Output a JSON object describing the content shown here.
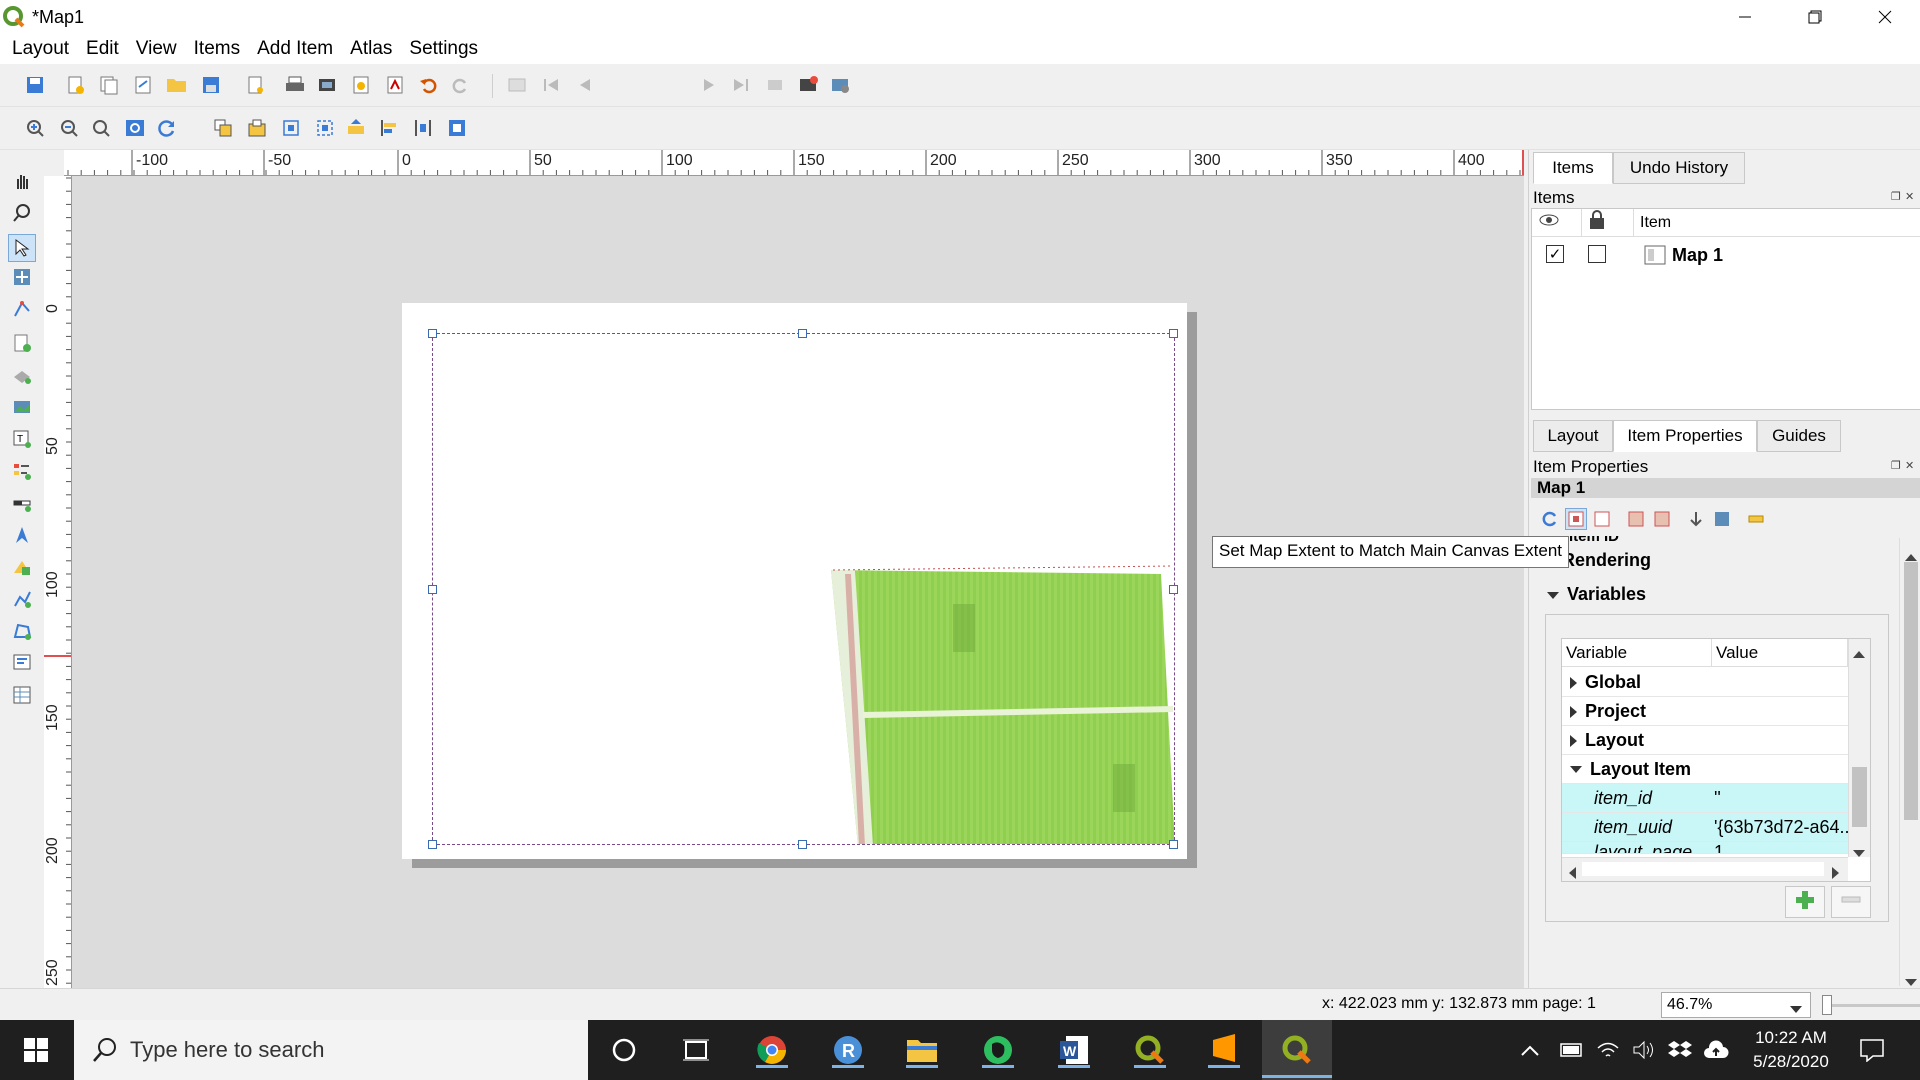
{
  "window": {
    "title": "*Map1"
  },
  "menu": [
    "Layout",
    "Edit",
    "View",
    "Items",
    "Add Item",
    "Atlas",
    "Settings"
  ],
  "toolbar": {
    "page_number": "1"
  },
  "hruler_labels": [
    "-100",
    "-50",
    "0",
    "50",
    "100",
    "150",
    "200",
    "250",
    "300",
    "350",
    "400"
  ],
  "vruler_labels": [
    "0",
    "50",
    "100",
    "150",
    "200",
    "250"
  ],
  "tooltip": "Set Map Extent to Match Main Canvas Extent",
  "panel_top": {
    "tabs": [
      "Items",
      "Undo History"
    ],
    "title": "Items",
    "column_item": "Item",
    "row_name": "Map 1"
  },
  "panel_bottom": {
    "tabs": [
      "Layout",
      "Item Properties",
      "Guides"
    ],
    "title": "Item Properties",
    "item_name": "Map 1",
    "partial_section": "Item ID",
    "sections": [
      "Rendering",
      "Variables"
    ],
    "var_columns": [
      "Variable",
      "Value"
    ],
    "var_groups": [
      "Global",
      "Project",
      "Layout",
      "Layout Item"
    ],
    "var_rows": [
      {
        "name": "item_id",
        "value": "''"
      },
      {
        "name": "item_uuid",
        "value": "'{63b73d72-a64..."
      },
      {
        "name": "layout_page",
        "value": "1"
      }
    ]
  },
  "status": {
    "coords": "x: 422.023 mm y: 132.873 mm page: 1",
    "zoom": "46.7%"
  },
  "taskbar": {
    "search_placeholder": "Type here to search",
    "time": "10:22 AM",
    "date": "5/28/2020"
  },
  "colors": {
    "accent": "#5b9bd5",
    "map_green": "#8fd14f",
    "qgis_green": "#589632"
  }
}
